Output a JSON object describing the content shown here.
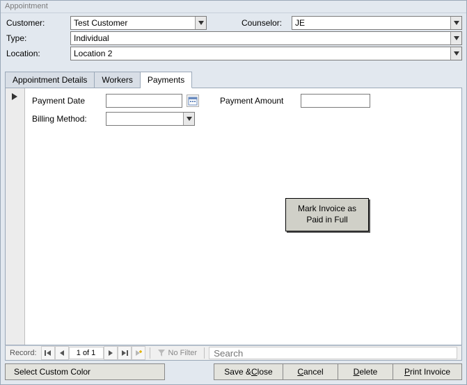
{
  "window": {
    "title": "Appointment"
  },
  "form": {
    "customer_label": "Customer:",
    "customer_value": "Test Customer",
    "counselor_label": "Counselor:",
    "counselor_value": "JE",
    "type_label": "Type:",
    "type_value": "Individual",
    "location_label": "Location:",
    "location_value": "Location 2"
  },
  "tabs": {
    "details": "Appointment Details",
    "workers": "Workers",
    "payments": "Payments"
  },
  "payments": {
    "payment_date_label": "Payment Date",
    "payment_date_value": "",
    "payment_amount_label": "Payment Amount",
    "payment_amount_value": "",
    "billing_method_label": "Billing Method:",
    "billing_method_value": "",
    "mark_invoice_btn": "Mark Invoice as Paid in Full"
  },
  "nav": {
    "record_label": "Record:",
    "position": "1 of 1",
    "no_filter": "No Filter",
    "search_placeholder": "Search"
  },
  "footer": {
    "custom_color": "Select Custom Color",
    "save_close": "Save & Close",
    "cancel": "Cancel",
    "delete": "Delete",
    "print_invoice": "Print Invoice"
  }
}
